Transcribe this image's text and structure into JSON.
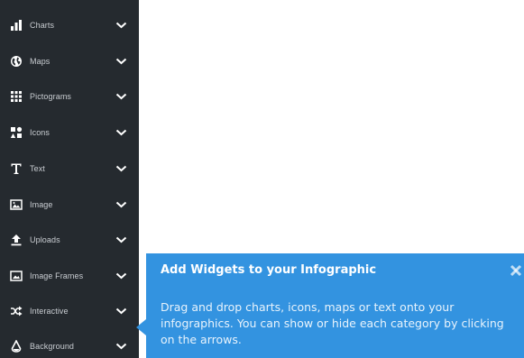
{
  "sidebar": {
    "items": [
      {
        "label": "Charts",
        "icon": "bar-chart-icon"
      },
      {
        "label": "Maps",
        "icon": "globe-icon"
      },
      {
        "label": "Pictograms",
        "icon": "grid-icon"
      },
      {
        "label": "Icons",
        "icon": "shapes-icon"
      },
      {
        "label": "Text",
        "icon": "text-icon"
      },
      {
        "label": "Image",
        "icon": "image-icon"
      },
      {
        "label": "Uploads",
        "icon": "upload-icon"
      },
      {
        "label": "Image Frames",
        "icon": "image-frame-icon"
      },
      {
        "label": "Interactive",
        "icon": "shuffle-icon"
      },
      {
        "label": "Background",
        "icon": "paint-bucket-icon"
      }
    ]
  },
  "tooltip": {
    "title": "Add Widgets to your Infographic",
    "body": "Drag and drop charts, icons, maps or text onto your infographics. You can show or hide each category by clicking on the arrows."
  },
  "colors": {
    "sidebar_bg": "#252a2f",
    "tooltip_bg": "#3393e0"
  }
}
